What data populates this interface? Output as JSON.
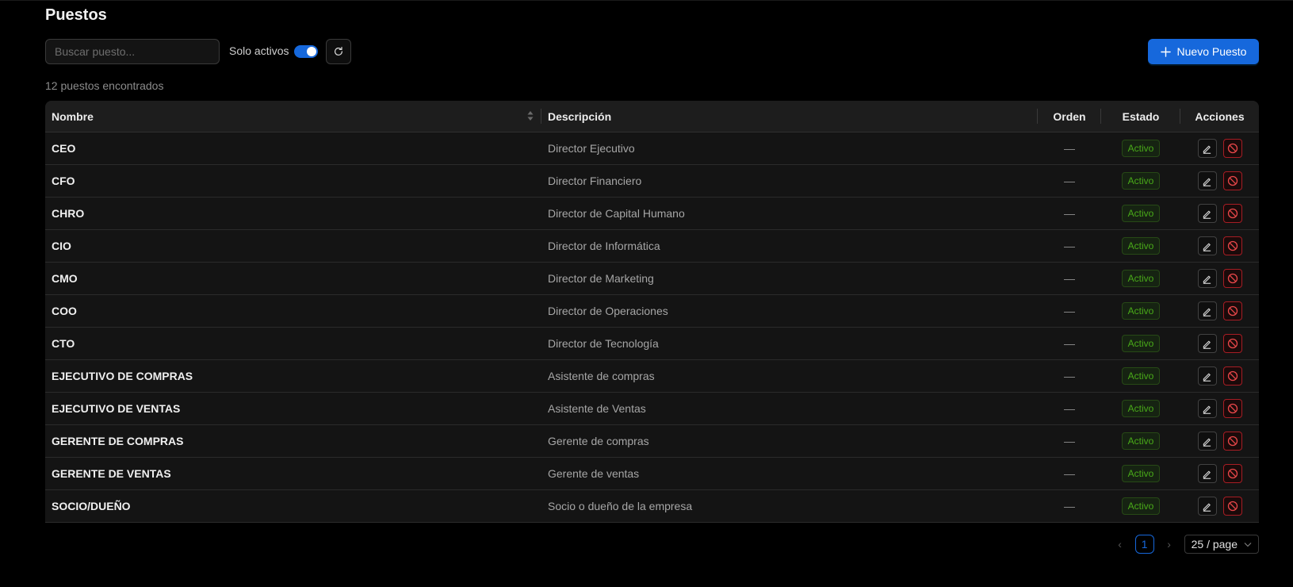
{
  "page": {
    "title": "Puestos"
  },
  "toolbar": {
    "search_placeholder": "Buscar puesto...",
    "search_value": "",
    "solo_label": "Solo activos",
    "solo_enabled": true,
    "new_label": "Nuevo Puesto"
  },
  "summary": {
    "count_text": "12 puestos encontrados"
  },
  "table": {
    "columns": [
      "Nombre",
      "Descripción",
      "Orden",
      "Estado",
      "Acciones"
    ],
    "rows": [
      {
        "nombre": "CEO",
        "descripcion": "Director Ejecutivo",
        "orden": "—",
        "estado": "Activo"
      },
      {
        "nombre": "CFO",
        "descripcion": "Director Financiero",
        "orden": "—",
        "estado": "Activo"
      },
      {
        "nombre": "CHRO",
        "descripcion": "Director de Capital Humano",
        "orden": "—",
        "estado": "Activo"
      },
      {
        "nombre": "CIO",
        "descripcion": "Director de Informática",
        "orden": "—",
        "estado": "Activo"
      },
      {
        "nombre": "CMO",
        "descripcion": "Director de Marketing",
        "orden": "—",
        "estado": "Activo"
      },
      {
        "nombre": "COO",
        "descripcion": "Director de Operaciones",
        "orden": "—",
        "estado": "Activo"
      },
      {
        "nombre": "CTO",
        "descripcion": "Director de Tecnología",
        "orden": "—",
        "estado": "Activo"
      },
      {
        "nombre": "EJECUTIVO DE COMPRAS",
        "descripcion": "Asistente de compras",
        "orden": "—",
        "estado": "Activo"
      },
      {
        "nombre": "EJECUTIVO DE VENTAS",
        "descripcion": "Asistente de Ventas",
        "orden": "—",
        "estado": "Activo"
      },
      {
        "nombre": "GERENTE DE COMPRAS",
        "descripcion": "Gerente de compras",
        "orden": "—",
        "estado": "Activo"
      },
      {
        "nombre": "GERENTE DE VENTAS",
        "descripcion": "Gerente de ventas",
        "orden": "—",
        "estado": "Activo"
      },
      {
        "nombre": "SOCIO/DUEÑO",
        "descripcion": "Socio o dueño de la empresa",
        "orden": "—",
        "estado": "Activo"
      }
    ]
  },
  "pagination": {
    "current_page": "1",
    "page_size_label": "25 / page"
  },
  "icons": {
    "refresh": "refresh-icon",
    "add": "plus-icon",
    "edit": "edit-icon",
    "disable": "stop-icon",
    "sort": "sort-icon",
    "prev": "chevron-left-icon",
    "next": "chevron-right-icon",
    "dropdown": "chevron-down-icon"
  },
  "colors": {
    "accent": "#1668dc",
    "success": "#49aa19",
    "danger": "#d32029",
    "background": "#000000"
  }
}
